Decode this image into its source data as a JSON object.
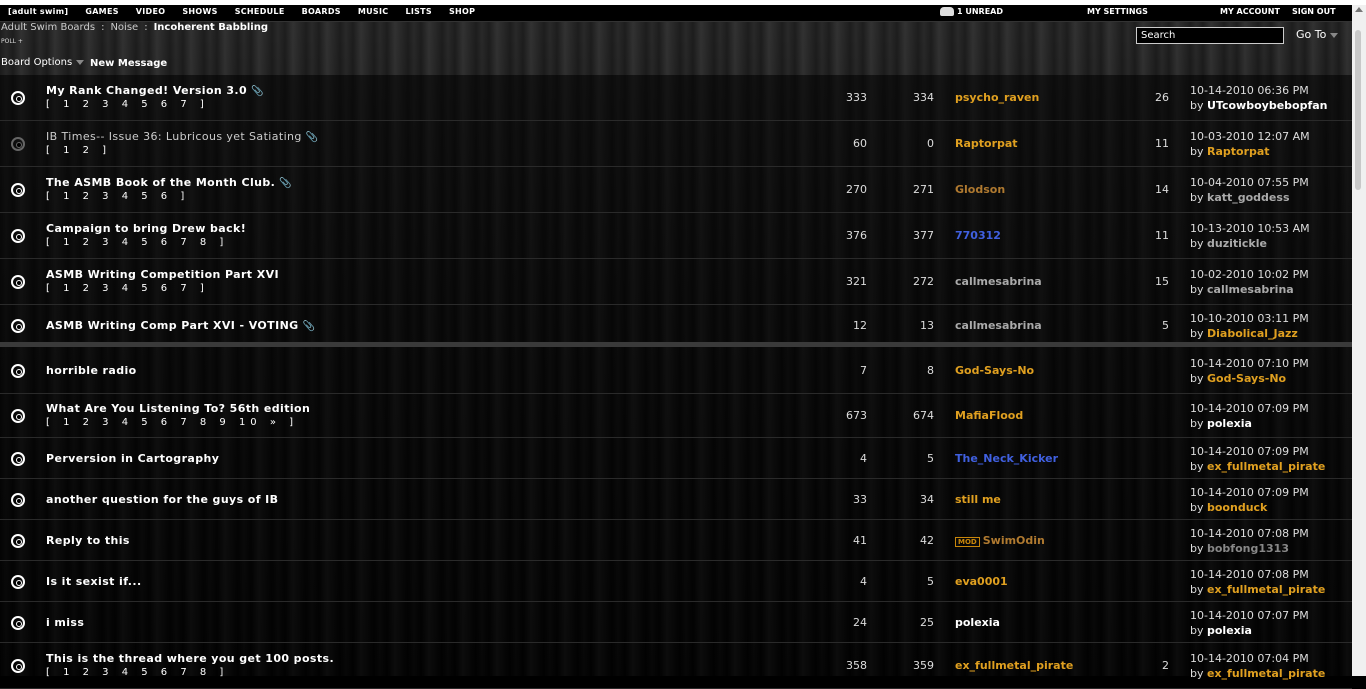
{
  "nav": {
    "items": [
      "[adult swim]",
      "GAMES",
      "VIDEO",
      "SHOWS",
      "SCHEDULE",
      "BOARDS",
      "MUSIC",
      "LISTS",
      "SHOP"
    ],
    "unread": "1 UNREAD",
    "my_settings": "MY SETTINGS",
    "my_account": "MY ACCOUNT",
    "sign_out": "SIGN OUT"
  },
  "breadcrumb": {
    "root": "Adult Swim Boards",
    "sep": ":",
    "section": "Noise",
    "board": "Incoherent Babbling"
  },
  "poll_label": "POLL +",
  "toolbar": {
    "board_options": "Board Options",
    "new_message": "New Message"
  },
  "search": {
    "placeholder": "Search",
    "goto": "Go To"
  },
  "colors": {
    "orange": "#e0a020",
    "blue": "#4060e0",
    "gray": "#aaaaaa",
    "white": "#ffffff",
    "brown": "#b07a30"
  },
  "threads": [
    {
      "title": "My Rank Changed! Version 3.0",
      "pages": "[ 1 2 3 4 5 6 7 ]",
      "views": "333",
      "posts": "334",
      "author": "psycho_raven",
      "author_color": "#e0a020",
      "replies": "26",
      "date": "10-14-2010 06:36 PM",
      "by": "UTcowboybebopfan",
      "by_color": "#ffffff",
      "clip": true,
      "dim": false,
      "normal": false
    },
    {
      "title": "IB Times-- Issue 36: Lubricous yet Satiating",
      "pages": "[ 1 2 ]",
      "views": "60",
      "posts": "0",
      "author": "Raptorpat",
      "author_color": "#e0a020",
      "replies": "11",
      "date": "10-03-2010 12:07 AM",
      "by": "Raptorpat",
      "by_color": "#e0a020",
      "clip": true,
      "dim": true,
      "normal": true
    },
    {
      "title": "The ASMB Book of the Month Club.",
      "pages": "[ 1 2 3 4 5 6 ]",
      "views": "270",
      "posts": "271",
      "author": "Glodson",
      "author_color": "#b07a30",
      "replies": "14",
      "date": "10-04-2010 07:55 PM",
      "by": "katt_goddess",
      "by_color": "#aaaaaa",
      "clip": true,
      "dim": false,
      "normal": false
    },
    {
      "title": "Campaign to bring Drew back!",
      "pages": "[ 1 2 3 4 5 6 7 8 ]",
      "views": "376",
      "posts": "377",
      "author": "770312",
      "author_color": "#4060e0",
      "replies": "11",
      "date": "10-13-2010 10:53 AM",
      "by": "duzitickle",
      "by_color": "#aaaaaa",
      "clip": false,
      "dim": false,
      "normal": false
    },
    {
      "title": "ASMB Writing Competition Part XVI",
      "pages": "[ 1 2 3 4 5 6 7 ]",
      "views": "321",
      "posts": "272",
      "author": "callmesabrina",
      "author_color": "#aaaaaa",
      "replies": "15",
      "date": "10-02-2010 10:02 PM",
      "by": "callmesabrina",
      "by_color": "#aaaaaa",
      "clip": false,
      "dim": false,
      "normal": false
    },
    {
      "title": "ASMB Writing Comp Part XVI - VOTING",
      "pages": "",
      "views": "12",
      "posts": "13",
      "author": "callmesabrina",
      "author_color": "#aaaaaa",
      "replies": "5",
      "date": "10-10-2010 03:11 PM",
      "by": "Diabolical_Jazz",
      "by_color": "#e0a020",
      "clip": true,
      "dim": false,
      "normal": false
    },
    {
      "title": "horrible radio",
      "pages": "",
      "views": "7",
      "posts": "8",
      "author": "God-Says-No",
      "author_color": "#e0a020",
      "replies": "",
      "date": "10-14-2010 07:10 PM",
      "by": "God-Says-No",
      "by_color": "#e0a020",
      "clip": false,
      "dim": false,
      "normal": false
    },
    {
      "title": "What Are You Listening To? 56th edition",
      "pages": "[ 1 2 3 4 5 6 7 8 9 10 » ]",
      "views": "673",
      "posts": "674",
      "author": "MafiaFlood",
      "author_color": "#e0a020",
      "replies": "",
      "date": "10-14-2010 07:09 PM",
      "by": "polexia",
      "by_color": "#ffffff",
      "clip": false,
      "dim": false,
      "normal": false
    },
    {
      "title": "Perversion in Cartography",
      "pages": "",
      "views": "4",
      "posts": "5",
      "author": "The_Neck_Kicker",
      "author_color": "#4060e0",
      "replies": "",
      "date": "10-14-2010 07:09 PM",
      "by": "ex_fullmetal_pirate",
      "by_color": "#e0a020",
      "clip": false,
      "dim": false,
      "normal": false
    },
    {
      "title": "another question for the guys of IB",
      "pages": "",
      "views": "33",
      "posts": "34",
      "author": "still me",
      "author_color": "#e0a020",
      "replies": "",
      "date": "10-14-2010 07:09 PM",
      "by": "boonduck",
      "by_color": "#e0a020",
      "clip": false,
      "dim": false,
      "normal": false
    },
    {
      "title": "Reply to this",
      "pages": "",
      "views": "41",
      "posts": "42",
      "author": "SwimOdin",
      "author_color": "#b07a30",
      "mod": "MOD",
      "replies": "",
      "date": "10-14-2010 07:08 PM",
      "by": "bobfong1313",
      "by_color": "#888888",
      "clip": false,
      "dim": false,
      "normal": false
    },
    {
      "title": "Is it sexist if...",
      "pages": "",
      "views": "4",
      "posts": "5",
      "author": "eva0001",
      "author_color": "#e0a020",
      "replies": "",
      "date": "10-14-2010 07:08 PM",
      "by": "ex_fullmetal_pirate",
      "by_color": "#e0a020",
      "clip": false,
      "dim": false,
      "normal": false
    },
    {
      "title": "i miss",
      "pages": "",
      "views": "24",
      "posts": "25",
      "author": "polexia",
      "author_color": "#ffffff",
      "replies": "",
      "date": "10-14-2010 07:07 PM",
      "by": "polexia",
      "by_color": "#ffffff",
      "clip": false,
      "dim": false,
      "normal": false
    },
    {
      "title": "This is the thread where you get 100 posts.",
      "pages": "[ 1 2 3 4 5 6 7 8 ]",
      "views": "358",
      "posts": "359",
      "author": "ex_fullmetal_pirate",
      "author_color": "#e0a020",
      "replies": "2",
      "date": "10-14-2010 07:04 PM",
      "by": "ex_fullmetal_pirate",
      "by_color": "#e0a020",
      "clip": false,
      "dim": false,
      "normal": false
    }
  ]
}
